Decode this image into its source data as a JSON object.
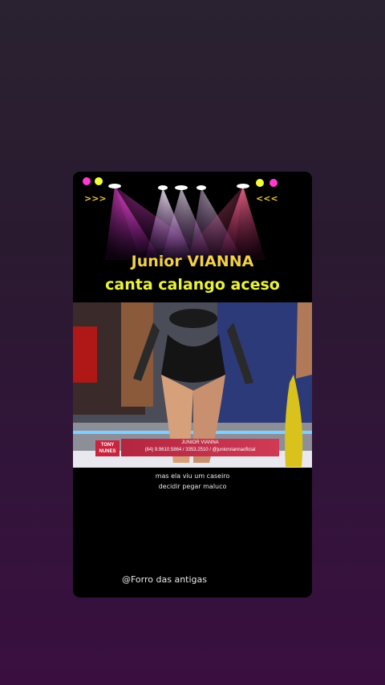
{
  "header": {
    "title_line1": "Junior VIANNA",
    "title_line2": "canta calango aceso"
  },
  "video": {
    "lower_third_name": "JUNIOR VIANNA",
    "lower_third_info": "(84) 9.9610.5864 / 3353.2510 / @juniorviannaoficial",
    "tv_logo": "TONY NUNES"
  },
  "subtitles": {
    "line1": "mas ela viu um caseiro",
    "line2": "decidir pegar maluco"
  },
  "watermark": "@Forro das antigas",
  "colors": {
    "title1": "#f3d048",
    "title2": "#eaf23c",
    "lower_third": "#c9243d"
  }
}
